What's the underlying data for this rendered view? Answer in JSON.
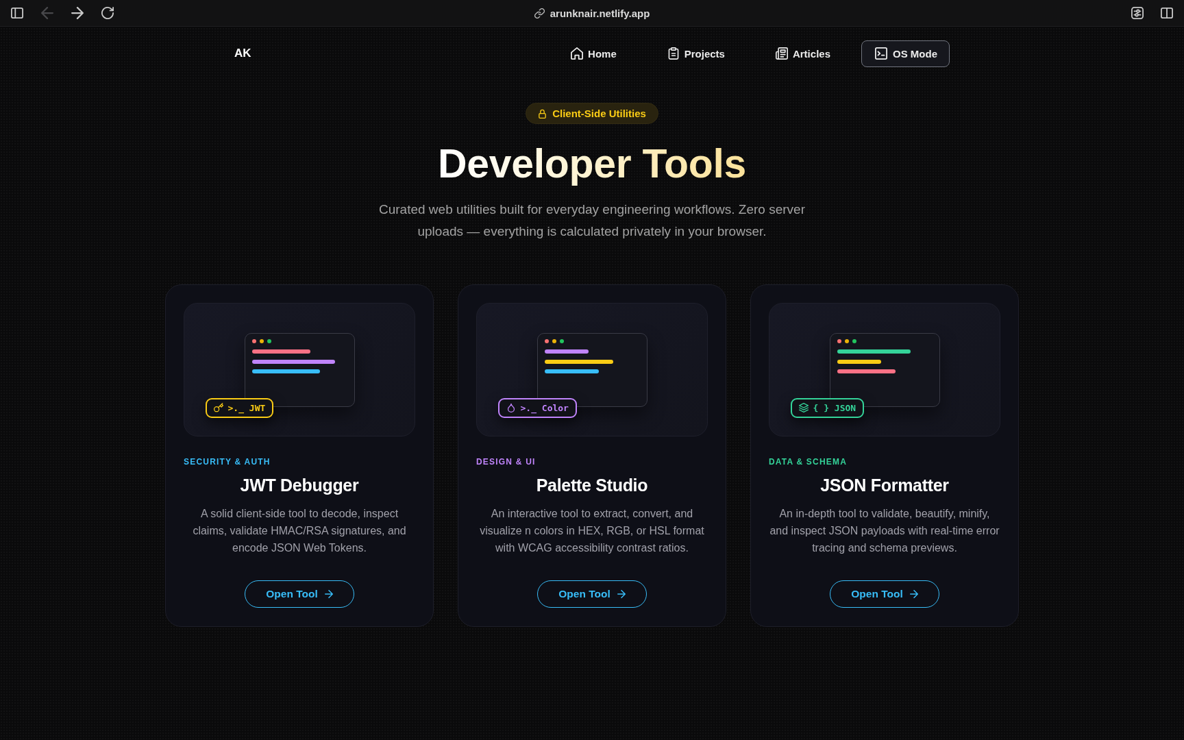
{
  "browser": {
    "back": {
      "disabled": true
    },
    "forward": {
      "disabled": false
    },
    "url": "arunknair.netlify.app"
  },
  "nav": {
    "logo": "AK",
    "items": [
      {
        "label": "Home",
        "kind": "link"
      },
      {
        "label": "Projects",
        "kind": "link"
      },
      {
        "label": "Articles",
        "kind": "link"
      },
      {
        "label": "OS Mode",
        "kind": "button"
      }
    ]
  },
  "hero": {
    "badge": "Client-Side Utilities",
    "title": "Developer Tools",
    "subtitle": "Curated web utilities built for everyday engineering workflows. Zero server uploads — everything is calculated privately in your browser."
  },
  "cards": [
    {
      "tag": {
        "label": ">._ JWT",
        "color": "#facc15"
      },
      "lines": [
        {
          "color": "#fb7185"
        },
        {
          "color": "#c084fc"
        },
        {
          "color": "#38bdf8"
        }
      ],
      "category": {
        "text": "SECURITY & AUTH",
        "color": "#38bdf8"
      },
      "title": "JWT Debugger",
      "description": "A solid client-side tool to decode, inspect claims, validate HMAC/RSA signatures, and encode JSON Web Tokens.",
      "button": "Open Tool"
    },
    {
      "tag": {
        "label": ">._ Color",
        "color": "#c084fc"
      },
      "lines": [
        {
          "color": "#c084fc"
        },
        {
          "color": "#facc15"
        },
        {
          "color": "#38bdf8"
        }
      ],
      "category": {
        "text": "DESIGN & UI",
        "color": "#c084fc"
      },
      "title": "Palette Studio",
      "description": "An interactive tool to extract, convert, and visualize n colors in HEX, RGB, or HSL format with WCAG accessibility contrast ratios.",
      "button": "Open Tool"
    },
    {
      "tag": {
        "label": "{ } JSON",
        "color": "#34d399"
      },
      "lines": [
        {
          "color": "#34d399"
        },
        {
          "color": "#facc15"
        },
        {
          "color": "#fb7185"
        }
      ],
      "category": {
        "text": "DATA & SCHEMA",
        "color": "#34d399"
      },
      "title": "JSON Formatter",
      "description": "An in-depth tool to validate, beautify, minify, and inspect JSON payloads with real-time error tracing and schema previews.",
      "button": "Open Tool"
    }
  ]
}
